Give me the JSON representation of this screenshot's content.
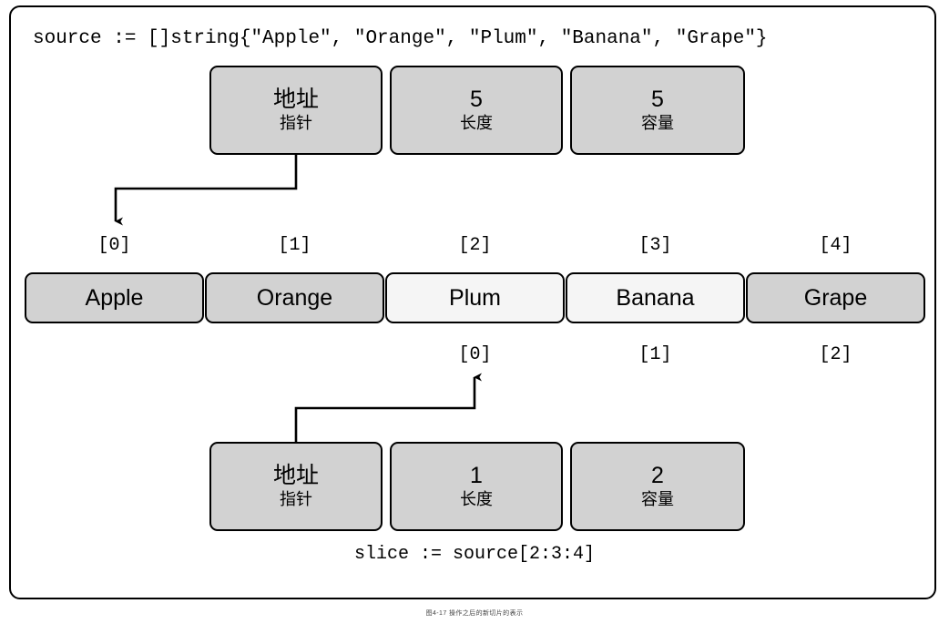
{
  "figure": {
    "caption": "图4-17 操作之后的新切片的表示"
  },
  "code": {
    "top": "source := []string{\"Apple\", \"Orange\", \"Plum\", \"Banana\", \"Grape\"}",
    "bottom": "slice := source[2:3:4]"
  },
  "source_header": {
    "pointer": {
      "value": "地址",
      "label": "指针"
    },
    "length": {
      "value": "5",
      "label": "长度"
    },
    "capacity": {
      "value": "5",
      "label": "容量"
    }
  },
  "slice_header": {
    "pointer": {
      "value": "地址",
      "label": "指针"
    },
    "length": {
      "value": "1",
      "label": "长度"
    },
    "capacity": {
      "value": "2",
      "label": "容量"
    }
  },
  "array": {
    "indices": [
      "[0]",
      "[1]",
      "[2]",
      "[3]",
      "[4]"
    ],
    "elements": [
      {
        "text": "Apple",
        "highlighted": false
      },
      {
        "text": "Orange",
        "highlighted": false
      },
      {
        "text": "Plum",
        "highlighted": true
      },
      {
        "text": "Banana",
        "highlighted": true
      },
      {
        "text": "Grape",
        "highlighted": false
      }
    ],
    "slice_indices": [
      "[0]",
      "[1]",
      "[2]"
    ]
  },
  "colors": {
    "cell_fill": "#d2d2d2",
    "cell_fill_highlight": "#f5f5f5",
    "border": "#000000",
    "background": "#ffffff"
  },
  "icons": {
    "pointer_arrow_top": "arrow-down-icon",
    "pointer_arrow_bottom": "arrow-up-icon"
  }
}
